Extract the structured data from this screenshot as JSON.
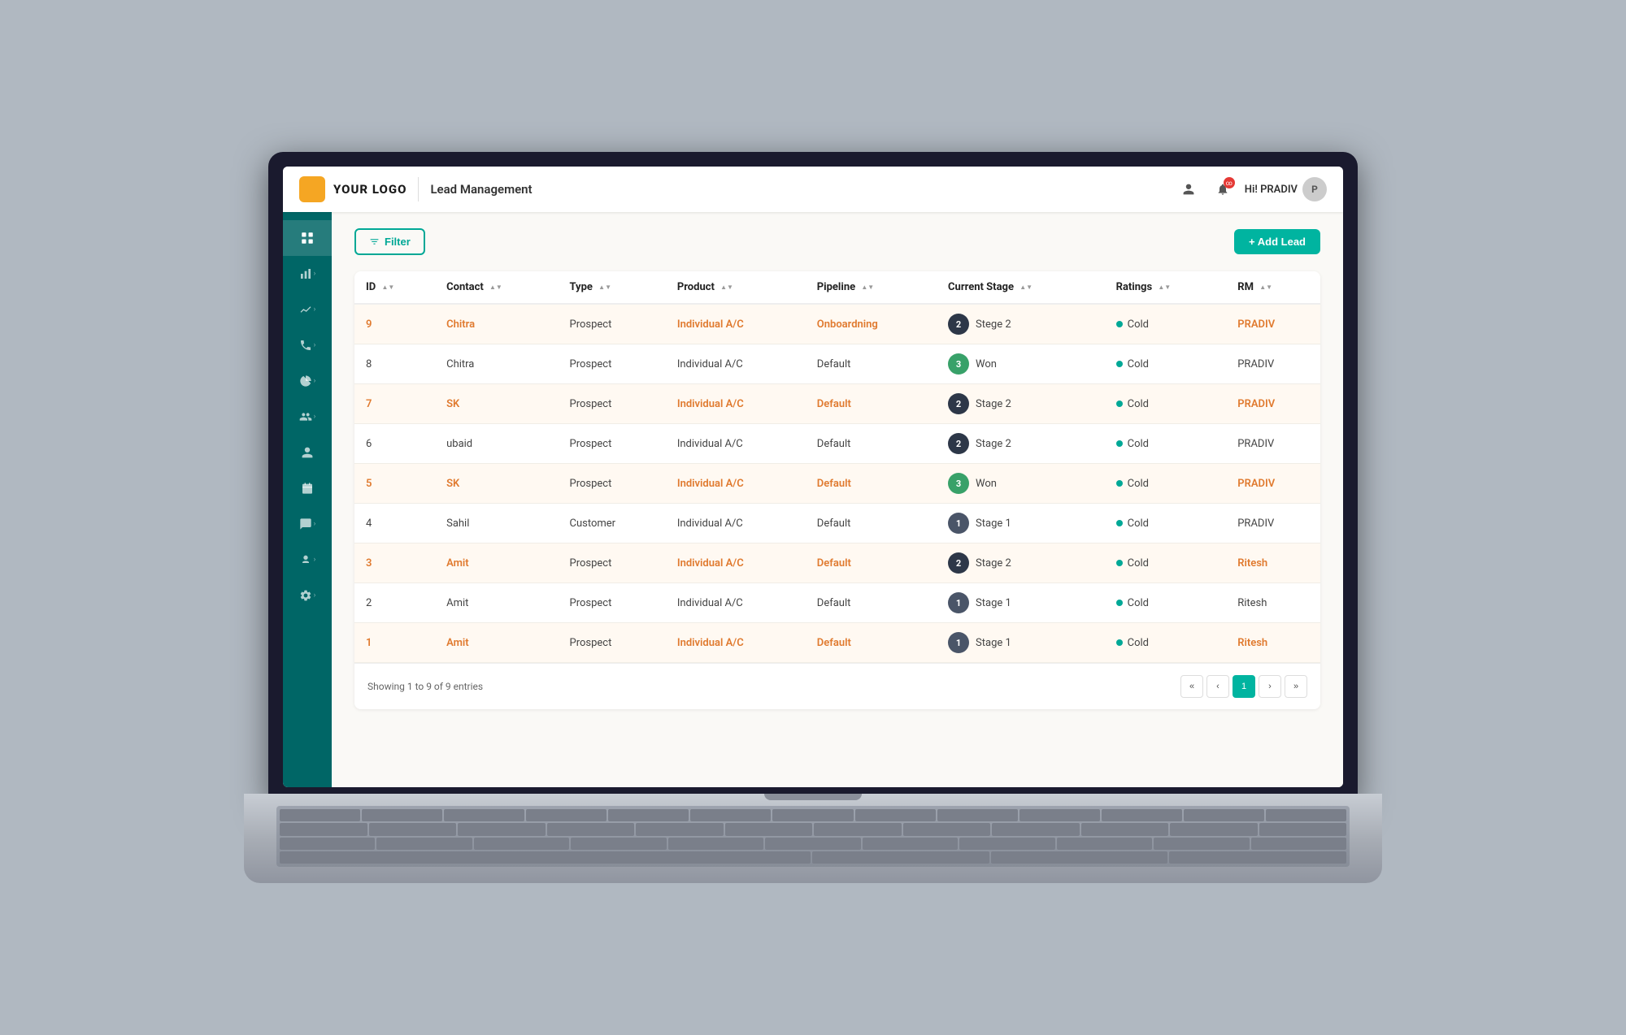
{
  "header": {
    "logo_text": "YOUR LOGO",
    "title": "Lead Management",
    "notif_count": "∞",
    "user_greeting": "Hi! PRADIV"
  },
  "sidebar": {
    "items": [
      {
        "icon": "⊞",
        "name": "dashboard",
        "active": true,
        "has_chevron": false
      },
      {
        "icon": "📊",
        "name": "reports",
        "active": false,
        "has_chevron": true
      },
      {
        "icon": "📈",
        "name": "analytics",
        "active": false,
        "has_chevron": true
      },
      {
        "icon": "📞",
        "name": "calls",
        "active": false,
        "has_chevron": true
      },
      {
        "icon": "🥧",
        "name": "pie-chart",
        "active": false,
        "has_chevron": true
      },
      {
        "icon": "👥",
        "name": "contacts",
        "active": false,
        "has_chevron": true
      },
      {
        "icon": "🧑",
        "name": "users",
        "active": false,
        "has_chevron": false
      },
      {
        "icon": "📅",
        "name": "calendar",
        "active": false,
        "has_chevron": false
      },
      {
        "icon": "📢",
        "name": "campaigns",
        "active": false,
        "has_chevron": true
      },
      {
        "icon": "👤",
        "name": "profile",
        "active": false,
        "has_chevron": true
      },
      {
        "icon": "⚙",
        "name": "settings",
        "active": false,
        "has_chevron": true
      }
    ]
  },
  "toolbar": {
    "filter_label": "Filter",
    "add_lead_label": "+ Add Lead"
  },
  "table": {
    "columns": [
      {
        "key": "id",
        "label": "ID",
        "sortable": true
      },
      {
        "key": "contact",
        "label": "Contact",
        "sortable": true
      },
      {
        "key": "type",
        "label": "Type",
        "sortable": true
      },
      {
        "key": "product",
        "label": "Product",
        "sortable": true
      },
      {
        "key": "pipeline",
        "label": "Pipeline",
        "sortable": true
      },
      {
        "key": "current_stage",
        "label": "Current Stage",
        "sortable": true
      },
      {
        "key": "ratings",
        "label": "Ratings",
        "sortable": true
      },
      {
        "key": "rm",
        "label": "RM",
        "sortable": true
      }
    ],
    "rows": [
      {
        "id": "9",
        "contact": "Chitra",
        "type": "Prospect",
        "product": "Individual A/C",
        "pipeline": "Onboardning",
        "stage_num": "2",
        "stage_label": "Stege 2",
        "stage_color": "dark",
        "rating": "Cold",
        "rm": "PRADIV",
        "highlight": true
      },
      {
        "id": "8",
        "contact": "Chitra",
        "type": "Prospect",
        "product": "Individual A/C",
        "pipeline": "Default",
        "stage_num": "3",
        "stage_label": "Won",
        "stage_color": "green",
        "rating": "Cold",
        "rm": "PRADIV",
        "highlight": false
      },
      {
        "id": "7",
        "contact": "SK",
        "type": "Prospect",
        "product": "Individual A/C",
        "pipeline": "Default",
        "stage_num": "2",
        "stage_label": "Stage 2",
        "stage_color": "dark",
        "rating": "Cold",
        "rm": "PRADIV",
        "highlight": true
      },
      {
        "id": "6",
        "contact": "ubaid",
        "type": "Prospect",
        "product": "Individual A/C",
        "pipeline": "Default",
        "stage_num": "2",
        "stage_label": "Stage 2",
        "stage_color": "dark",
        "rating": "Cold",
        "rm": "PRADIV",
        "highlight": false
      },
      {
        "id": "5",
        "contact": "SK",
        "type": "Prospect",
        "product": "Individual A/C",
        "pipeline": "Default",
        "stage_num": "3",
        "stage_label": "Won",
        "stage_color": "green",
        "rating": "Cold",
        "rm": "PRADIV",
        "highlight": true
      },
      {
        "id": "4",
        "contact": "Sahil",
        "type": "Customer",
        "product": "Individual A/C",
        "pipeline": "Default",
        "stage_num": "1",
        "stage_label": "Stage 1",
        "stage_color": "light-dark",
        "rating": "Cold",
        "rm": "PRADIV",
        "highlight": false
      },
      {
        "id": "3",
        "contact": "Amit",
        "type": "Prospect",
        "product": "Individual A/C",
        "pipeline": "Default",
        "stage_num": "2",
        "stage_label": "Stage 2",
        "stage_color": "dark",
        "rating": "Cold",
        "rm": "Ritesh",
        "highlight": true
      },
      {
        "id": "2",
        "contact": "Amit",
        "type": "Prospect",
        "product": "Individual A/C",
        "pipeline": "Default",
        "stage_num": "1",
        "stage_label": "Stage 1",
        "stage_color": "light-dark",
        "rating": "Cold",
        "rm": "Ritesh",
        "highlight": false
      },
      {
        "id": "1",
        "contact": "Amit",
        "type": "Prospect",
        "product": "Individual A/C",
        "pipeline": "Default",
        "stage_num": "1",
        "stage_label": "Stage 1",
        "stage_color": "light-dark",
        "rating": "Cold",
        "rm": "Ritesh",
        "highlight": true
      }
    ]
  },
  "footer": {
    "showing_text": "Showing 1 to 9 of 9 entries"
  },
  "pagination": {
    "current": "1",
    "pages": [
      "1"
    ]
  },
  "colors": {
    "primary": "#00b4a0",
    "accent": "#e07a2f",
    "sidebar_bg": "#006666",
    "stage_dark": "#2d3748",
    "stage_green": "#38a169",
    "stage_light": "#4a5568",
    "rating_dot": "#00a896"
  }
}
